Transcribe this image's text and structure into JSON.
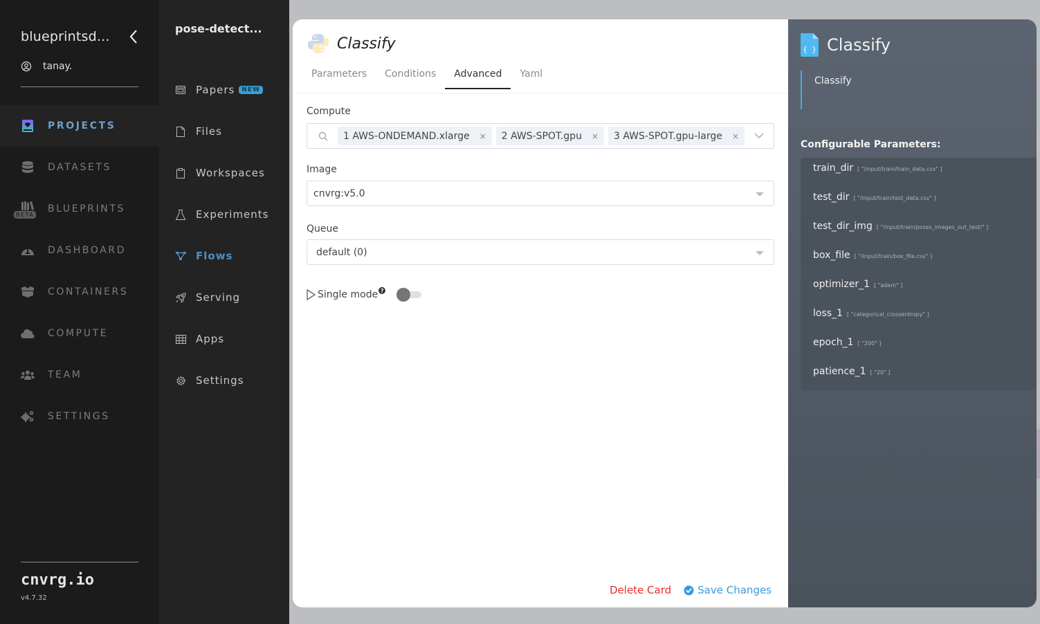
{
  "sidebar": {
    "org_name": "blueprintsd...",
    "user_name": "tanay.",
    "nav": [
      {
        "label": "PROJECTS",
        "icon": "projects-book-icon",
        "active": true
      },
      {
        "label": "DATASETS",
        "icon": "database-icon"
      },
      {
        "label": "BLUEPRINTS",
        "icon": "blueprints-books-icon",
        "badge": "BETA"
      },
      {
        "label": "DASHBOARD",
        "icon": "dashboard-gauge-icon"
      },
      {
        "label": "CONTAINERS",
        "icon": "container-box-icon"
      },
      {
        "label": "COMPUTE",
        "icon": "cloud-icon"
      },
      {
        "label": "TEAM",
        "icon": "team-users-icon"
      },
      {
        "label": "SETTINGS",
        "icon": "gears-icon"
      }
    ],
    "brand": "cnvrg.io",
    "version": "v4.7.32"
  },
  "project_sidebar": {
    "title": "pose-detect...",
    "nav": [
      {
        "label": "Papers",
        "icon": "papers-icon",
        "badge": "NEW"
      },
      {
        "label": "Files",
        "icon": "file-icon"
      },
      {
        "label": "Workspaces",
        "icon": "clipboard-icon"
      },
      {
        "label": "Experiments",
        "icon": "flask-icon"
      },
      {
        "label": "Flows",
        "icon": "flows-icon",
        "active": true
      },
      {
        "label": "Serving",
        "icon": "rocket-icon"
      },
      {
        "label": "Apps",
        "icon": "grid-icon"
      },
      {
        "label": "Settings",
        "icon": "gear-icon"
      }
    ]
  },
  "card": {
    "title": "Classify",
    "tabs": [
      "Parameters",
      "Conditions",
      "Advanced",
      "Yaml"
    ],
    "active_tab": "Advanced",
    "compute": {
      "label": "Compute",
      "selected": [
        "1 AWS-ONDEMAND.xlarge",
        "2 AWS-SPOT.gpu",
        "3 AWS-SPOT.gpu-large"
      ],
      "remove_glyph": "×"
    },
    "image": {
      "label": "Image",
      "value": "cnvrg:v5.0"
    },
    "queue": {
      "label": "Queue",
      "value": "default (0)"
    },
    "single_mode": {
      "label": "Single mode",
      "help": "?",
      "enabled": false
    },
    "delete_label": "Delete Card",
    "save_label": "Save Changes"
  },
  "info_panel": {
    "title": "Classify",
    "description": "Classify",
    "params_title": "Configurable Parameters:",
    "params": [
      {
        "name": "train_dir",
        "value": "[ \"/input/train/train_data.csv\" ]"
      },
      {
        "name": "test_dir",
        "value": "[ \"/input/train/test_data.csv\" ]"
      },
      {
        "name": "test_dir_img",
        "value": "[ \"/input/train/poses_images_out_test/\" ]"
      },
      {
        "name": "box_file",
        "value": "[ \"/input/train/box_file.csv\" ]"
      },
      {
        "name": "optimizer_1",
        "value": "[ \"adam\" ]"
      },
      {
        "name": "loss_1",
        "value": "[ \"categorical_crossentropy\" ]"
      },
      {
        "name": "epoch_1",
        "value": "[ \"200\" ]"
      },
      {
        "name": "patience_1",
        "value": "[ \"20\" ]"
      }
    ]
  },
  "colors": {
    "accent": "#6fa0c8",
    "flows_active": "#4f8fc0",
    "new_badge": "#3aa0cf",
    "delete": "#ef2b2b",
    "save": "#3a9bde",
    "info_bg": "#5b6470"
  }
}
